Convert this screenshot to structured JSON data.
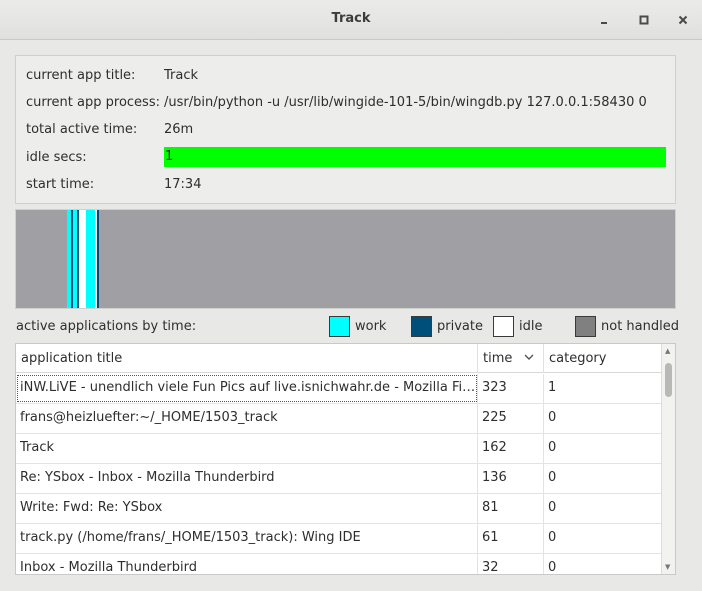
{
  "window": {
    "title": "Track"
  },
  "info": {
    "app_title_label": "current app title:",
    "app_title_value": "Track",
    "process_label": "current app process:",
    "process_value": "/usr/bin/python -u /usr/lib/wingide-101-5/bin/wingdb.py 127.0.0.1:58430 0",
    "total_active_label": "total active time:",
    "total_active_value": "26m",
    "idle_label": "idle secs:",
    "idle_value": "1",
    "start_label": "start time:",
    "start_value": "17:34"
  },
  "legend": {
    "title": "active applications by time:",
    "items": [
      {
        "label": "work",
        "color": "#00ffff"
      },
      {
        "label": "private",
        "color": "#004f7a"
      },
      {
        "label": "idle",
        "color": "#ffffff"
      },
      {
        "label": "not handled",
        "color": "#808080"
      }
    ]
  },
  "colors": {
    "idle_bar": "#00ff00",
    "timeline_bg": "#a0a0a4"
  },
  "table": {
    "columns": [
      {
        "label": "application title"
      },
      {
        "label": "time",
        "sort": "descending"
      },
      {
        "label": "category"
      }
    ],
    "rows": [
      {
        "title": "iNW.LiVE - unendlich viele Fun Pics auf live.isnichwahr.de - Mozilla Firefox",
        "time": "323",
        "category": "1"
      },
      {
        "title": "frans@heizluefter:~/_HOME/1503_track",
        "time": "225",
        "category": "0"
      },
      {
        "title": "Track",
        "time": "162",
        "category": "0"
      },
      {
        "title": "Re: YSbox - Inbox - Mozilla Thunderbird",
        "time": "136",
        "category": "0"
      },
      {
        "title": "Write: Fwd: Re: YSbox",
        "time": "81",
        "category": "0"
      },
      {
        "title": "track.py (/home/frans/_HOME/1503_track): Wing IDE",
        "time": "61",
        "category": "0"
      },
      {
        "title": "Inbox - Mozilla Thunderbird",
        "time": "32",
        "category": "0"
      }
    ]
  }
}
